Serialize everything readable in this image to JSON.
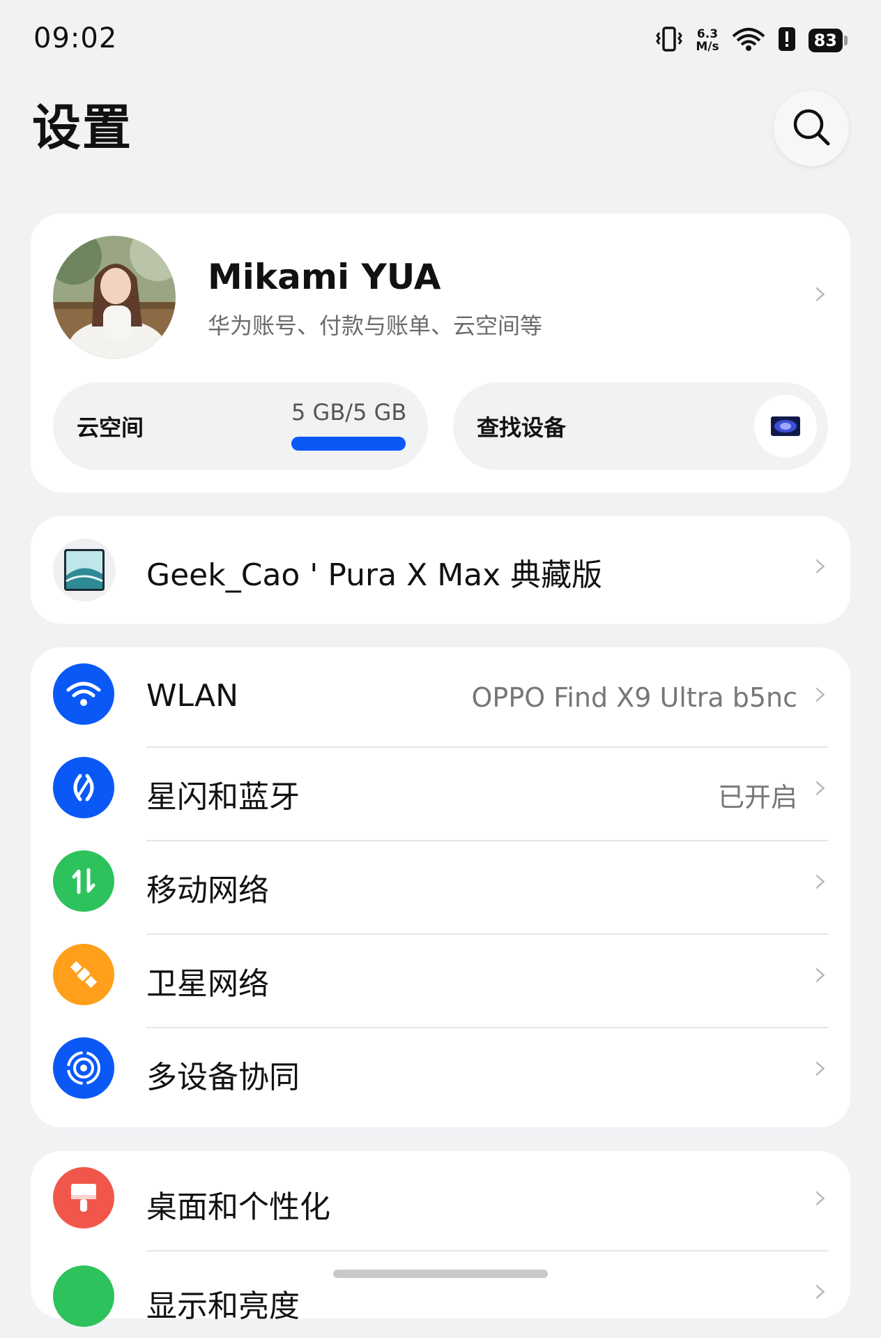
{
  "status_bar": {
    "time": "09:02",
    "net_speed_value": "6.3",
    "net_speed_unit": "M/s",
    "battery": "83",
    "icons": [
      "vibrate-icon",
      "wifi-icon",
      "alert-icon",
      "battery-icon"
    ]
  },
  "header": {
    "title": "设置",
    "search_icon": "search-icon"
  },
  "account": {
    "name": "Mikami YUA",
    "subtitle": "华为账号、付款与账单、云空间等",
    "cloud_label": "云空间",
    "cloud_usage": "5 GB/5 GB",
    "cloud_usage_fraction": 1.0,
    "find_device_label": "查找设备"
  },
  "device": {
    "name": "Geek_Cao ' Pura X Max 典藏版"
  },
  "connectivity": [
    {
      "label": "WLAN",
      "value": "OPPO Find X9 Ultra b5nc",
      "icon": "wifi-icon",
      "color": "#0a59f7"
    },
    {
      "label": "星闪和蓝牙",
      "value": "已开启",
      "icon": "bluetooth-icon",
      "color": "#0a59f7"
    },
    {
      "label": "移动网络",
      "value": "",
      "icon": "mobile-data-icon",
      "color": "#2ec25c"
    },
    {
      "label": "卫星网络",
      "value": "",
      "icon": "satellite-icon",
      "color": "#ff9f1a"
    },
    {
      "label": "多设备协同",
      "value": "",
      "icon": "multi-device-icon",
      "color": "#0a59f7"
    }
  ],
  "personalization": [
    {
      "label": "桌面和个性化",
      "icon": "brush-icon",
      "color": "#f0574a"
    },
    {
      "label": "显示和亮度",
      "icon": "display-icon",
      "color": "#2ec25c"
    }
  ]
}
